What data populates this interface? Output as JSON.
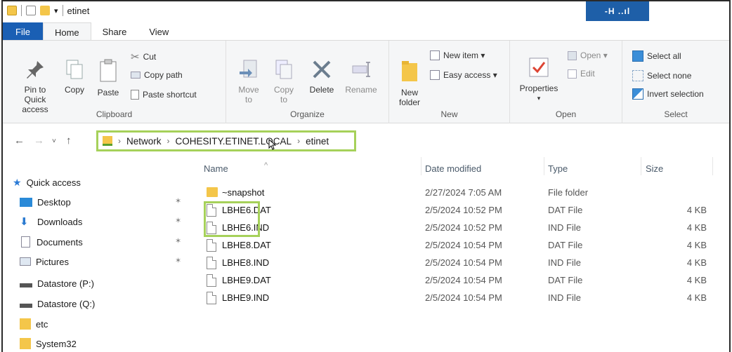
{
  "window": {
    "title": "etinet",
    "signal": "-H ..ıl"
  },
  "tabs": [
    "File",
    "Home",
    "Share",
    "View"
  ],
  "ribbon": {
    "clipboard": {
      "pin": "Pin to Quick access",
      "copy": "Copy",
      "paste": "Paste",
      "cut": "Cut",
      "copy_path": "Copy path",
      "paste_shortcut": "Paste shortcut",
      "label": "Clipboard"
    },
    "organize": {
      "move_to": "Move to",
      "copy_to": "Copy to",
      "delete": "Delete",
      "rename": "Rename",
      "label": "Organize"
    },
    "new": {
      "new_folder": "New folder",
      "new_item": "New item ▾",
      "easy_access": "Easy access ▾",
      "label": "New"
    },
    "open": {
      "properties": "Properties",
      "open": "Open ▾",
      "edit": "Edit",
      "label": "Open"
    },
    "select": {
      "select_all": "Select all",
      "select_none": "Select none",
      "invert": "Invert selection",
      "label": "Select"
    }
  },
  "address": {
    "crumbs": [
      "Network",
      "COHESITY.ETINET.LOCAL",
      "etinet"
    ]
  },
  "navpane": {
    "items": [
      {
        "label": "Quick access",
        "icon": "star-icon",
        "pinned": false
      },
      {
        "label": "Desktop",
        "icon": "desktop-icon",
        "pinned": true
      },
      {
        "label": "Downloads",
        "icon": "download-icon",
        "pinned": true
      },
      {
        "label": "Documents",
        "icon": "document-icon",
        "pinned": true
      },
      {
        "label": "Pictures",
        "icon": "pictures-icon",
        "pinned": true
      },
      {
        "label": "Datastore (P:)",
        "icon": "drive-icon",
        "pinned": false
      },
      {
        "label": "Datastore (Q:)",
        "icon": "drive-icon",
        "pinned": false
      },
      {
        "label": "etc",
        "icon": "folder-icon",
        "pinned": false
      },
      {
        "label": "System32",
        "icon": "folder-icon",
        "pinned": false
      }
    ]
  },
  "columns": {
    "name": "Name",
    "date": "Date modified",
    "type": "Type",
    "size": "Size"
  },
  "files": [
    {
      "name": "~snapshot",
      "date": "2/27/2024 7:05 AM",
      "type": "File folder",
      "size": "",
      "kind": "folder"
    },
    {
      "name": "LBHE6.DAT",
      "date": "2/5/2024 10:52 PM",
      "type": "DAT File",
      "size": "4 KB",
      "kind": "file"
    },
    {
      "name": "LBHE6.IND",
      "date": "2/5/2024 10:52 PM",
      "type": "IND File",
      "size": "4 KB",
      "kind": "file"
    },
    {
      "name": "LBHE8.DAT",
      "date": "2/5/2024 10:54 PM",
      "type": "DAT File",
      "size": "4 KB",
      "kind": "file"
    },
    {
      "name": "LBHE8.IND",
      "date": "2/5/2024 10:54 PM",
      "type": "IND File",
      "size": "4 KB",
      "kind": "file"
    },
    {
      "name": "LBHE9.DAT",
      "date": "2/5/2024 10:54 PM",
      "type": "DAT File",
      "size": "4 KB",
      "kind": "file"
    },
    {
      "name": "LBHE9.IND",
      "date": "2/5/2024 10:54 PM",
      "type": "IND File",
      "size": "4 KB",
      "kind": "file"
    }
  ],
  "colors": {
    "accent": "#1a5fb4",
    "highlight": "#a6d15a",
    "folder": "#f4c64a"
  }
}
